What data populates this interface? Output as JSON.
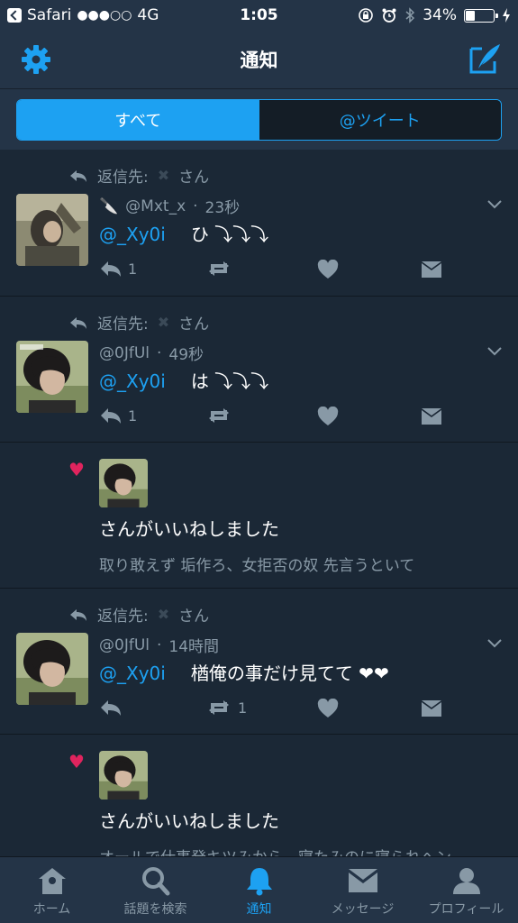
{
  "status": {
    "carrier": "Safari",
    "signal": "●●●○○",
    "network": "4G",
    "time": "1:05",
    "battery": "34%",
    "battery_level": 0.34
  },
  "nav": {
    "title": "通知"
  },
  "segments": {
    "all": "すべて",
    "mentions": "@ツイート"
  },
  "items": [
    {
      "type": "reply",
      "reply_prefix": "返信先:",
      "reply_suffix": "さん",
      "handle": "@Mxt_x",
      "time": "23秒",
      "mention": "@_Xy0i",
      "text": "ひ ⤵︎⤵︎⤵︎",
      "reply_count": "1",
      "retweet_count": ""
    },
    {
      "type": "reply",
      "reply_prefix": "返信先:",
      "reply_suffix": "さん",
      "handle": "@0JfUl",
      "time": "49秒",
      "mention": "@_Xy0i",
      "text": "は ⤵︎⤵︎⤵︎",
      "reply_count": "1",
      "retweet_count": ""
    },
    {
      "type": "like",
      "title": "さんがいいねしました",
      "quote": "取り敢えず 垢作ろ、女拒否の奴 先言うといて"
    },
    {
      "type": "reply",
      "reply_prefix": "返信先:",
      "reply_suffix": "さん",
      "handle": "@0JfUl",
      "time": "14時間",
      "mention": "@_Xy0i",
      "text": "楢俺の事だけ見てて ❤︎❤︎",
      "reply_count": "",
      "retweet_count": "1"
    },
    {
      "type": "like",
      "title": "さんがいいねしました",
      "quote": "オールで仕事発キツみから、寝たみのに寝られへン"
    }
  ],
  "tabs": [
    {
      "label": "ホーム",
      "icon": "home-icon"
    },
    {
      "label": "話題を検索",
      "icon": "search-icon"
    },
    {
      "label": "通知",
      "icon": "bell-icon"
    },
    {
      "label": "メッセージ",
      "icon": "envelope-icon"
    },
    {
      "label": "プロフィール",
      "icon": "person-icon"
    }
  ],
  "colors": {
    "accent": "#1da1f2",
    "background": "#1b2836",
    "bar": "#243447",
    "like": "#e0245e",
    "muted": "#8899a6"
  }
}
